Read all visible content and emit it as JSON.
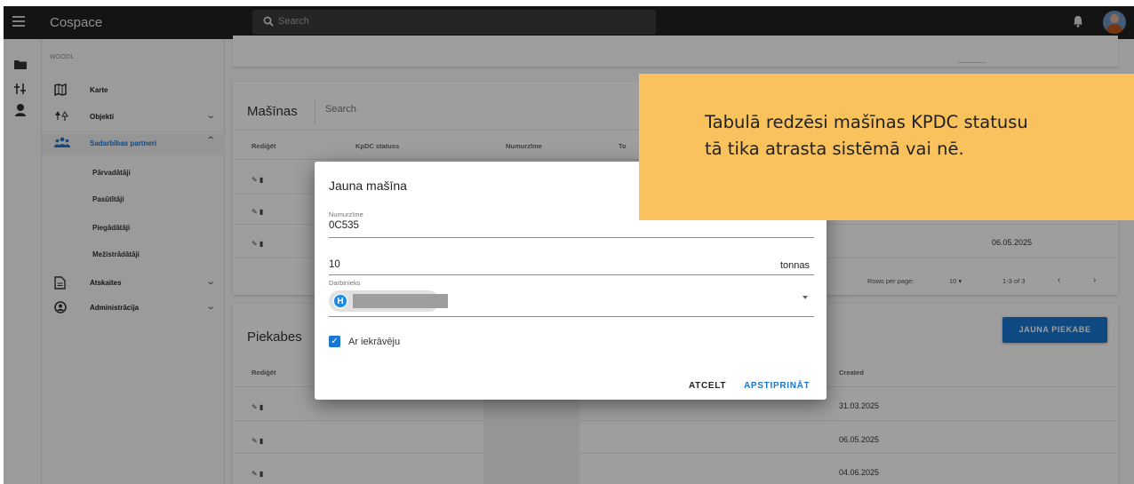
{
  "app": {
    "title": "Cospace",
    "org": "WOODL",
    "search_placeholder": "Search"
  },
  "sidebar": {
    "items": [
      {
        "label": "Karte",
        "icon": "map-icon"
      },
      {
        "label": "Objekti",
        "icon": "tree-icon"
      },
      {
        "label": "Sadarbības partneri",
        "icon": "people-icon"
      },
      {
        "label": "Atskaites",
        "icon": "document-icon"
      },
      {
        "label": "Administrācija",
        "icon": "account-circle-icon"
      }
    ],
    "subitems": [
      "Pārvadātāji",
      "Pasūtītāji",
      "Piegādātāji",
      "Mežistrādātāji"
    ]
  },
  "masinas": {
    "title": "Mašīnas",
    "search_placeholder": "Search",
    "columns": [
      "Rediģēt",
      "KpDC statuss",
      "Numurzīme",
      "To"
    ],
    "visible_date": "06.05.2025",
    "pager": {
      "label": "Rows per page:",
      "value": "10",
      "range": "1-3 of 3"
    }
  },
  "piekabes": {
    "title": "Piekabes",
    "columns": [
      "Rediģēt",
      "Created"
    ],
    "rows": [
      "31.03.2025",
      "06.05.2025",
      "04.06.2025"
    ],
    "new_button": "JAUNA PIEKABE"
  },
  "dialog": {
    "title": "Jauna mašīna",
    "plate_label": "Numurzīme",
    "plate_value": "0C535",
    "tonnage_value": "10",
    "tonnage_unit": "tonnas",
    "employee_label": "Darbinieks",
    "employee_initial": "H",
    "checkbox_label": "Ar iekrāvēju",
    "cancel": "ATCELT",
    "confirm": "APSTIPRINĀT"
  },
  "note": {
    "line1": "Tabulā redzēsi mašīnas KPDC statusu",
    "line2": "tā tika atrasta sistēmā vai nē."
  },
  "colors": {
    "accent": "#1976d2",
    "note_bg": "#f9c25c",
    "topbar": "#212121"
  }
}
